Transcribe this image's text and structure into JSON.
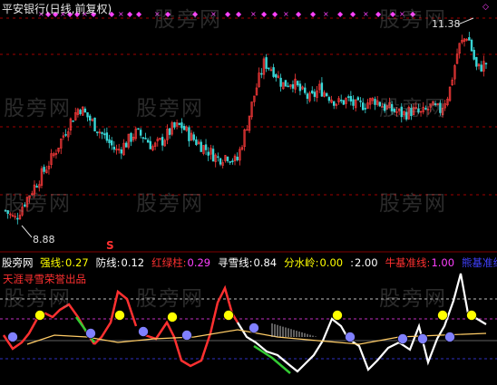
{
  "chart_title": "平安银行(日线,前复权)",
  "price_high_label": "11.38",
  "price_low_label": "8.88",
  "signal_marker": "S",
  "watermark": "股旁网",
  "indicator": {
    "name": "股旁网",
    "subtitle": "天涯寻雪荣誉出品",
    "items": [
      {
        "label": "强线:",
        "value": "0.27",
        "label_color": "#ffff00",
        "value_color": "#ffff00"
      },
      {
        "label": "防线:",
        "value": "0.12",
        "label_color": "#ffffff",
        "value_color": "#ffffff"
      },
      {
        "label": "红绿柱:",
        "value": "0.29",
        "label_color": "#ff3030",
        "value_color": "#ff40ff"
      },
      {
        "label": "寻雪线:",
        "value": "0.84",
        "label_color": "#ffffff",
        "value_color": "#ffffff"
      },
      {
        "label": "分水岭:",
        "value": "0.00",
        "label_color": "#ffff00",
        "value_color": "#ffff00"
      },
      {
        "label": ":",
        "value": "2.00",
        "label_color": "#ffffff",
        "value_color": "#ffffff"
      },
      {
        "label": "牛基准线:",
        "value": "1.00",
        "label_color": "#ff3030",
        "value_color": "#ff40ff"
      },
      {
        "label": "熊基准线:",
        "value": "",
        "label_color": "#4040ff",
        "value_color": "#4040ff"
      }
    ]
  },
  "colors": {
    "up_candle": "#ff3b3b",
    "down_candle": "#39d8d8",
    "grid": "#a00000",
    "markers": "#ff40ff"
  },
  "chart_data": {
    "type": "candlestick",
    "title": "平安银行(日线,前复权)",
    "price_range": [
      8.6,
      11.6
    ],
    "close_path": [
      9.0,
      8.88,
      9.1,
      9.3,
      9.5,
      9.7,
      9.95,
      10.2,
      10.4,
      10.25,
      10.1,
      9.95,
      9.8,
      9.9,
      10.05,
      10.0,
      9.85,
      9.95,
      10.1,
      10.15,
      10.0,
      9.9,
      9.8,
      9.7,
      9.75,
      9.65,
      10.1,
      10.6,
      11.0,
      10.9,
      10.7,
      10.75,
      10.6,
      10.5,
      10.65,
      10.55,
      10.45,
      10.5,
      10.4,
      10.45,
      10.5,
      10.4,
      10.35,
      10.3,
      10.35,
      10.3,
      10.4,
      10.35,
      10.6,
      11.2,
      11.38,
      10.9,
      11.0
    ],
    "annotations": [
      {
        "text": "11.38",
        "type": "high"
      },
      {
        "text": "8.88",
        "type": "low"
      }
    ]
  }
}
